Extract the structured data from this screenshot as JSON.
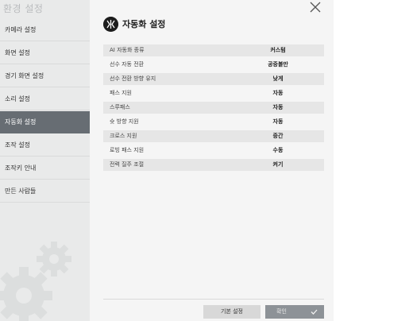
{
  "sidebar": {
    "header": "환경 설정",
    "items": [
      {
        "label": "카메라 설정"
      },
      {
        "label": "화면 설정"
      },
      {
        "label": "경기 화면 설정"
      },
      {
        "label": "소리 설정"
      },
      {
        "label": "자동화 설정"
      },
      {
        "label": "조작 설정"
      },
      {
        "label": "조작키 안내"
      },
      {
        "label": "만든 사람들"
      }
    ],
    "active_index": 4
  },
  "main": {
    "title": "자동화 설정",
    "settings": [
      {
        "label": "AI 자동화 종류",
        "value": "커스텀"
      },
      {
        "label": "선수 자동 전환",
        "value": "공중볼만"
      },
      {
        "label": "선수 전환 방향 유지",
        "value": "낮게"
      },
      {
        "label": "패스 지원",
        "value": "자동"
      },
      {
        "label": "스루패스",
        "value": "자동"
      },
      {
        "label": "슛 방향 지원",
        "value": "자동"
      },
      {
        "label": "크로스 지원",
        "value": "중간"
      },
      {
        "label": "로빙 패스 지원",
        "value": "수동"
      },
      {
        "label": "전력 질주 조절",
        "value": "켜기"
      }
    ]
  },
  "footer": {
    "default_label": "기본 설정",
    "ok_label": "확인"
  },
  "colors": {
    "sidebar_bg": "#e9eaea",
    "active_item": "#676d73",
    "panel_bg": "#f5f5f5",
    "row_shade": "#e6e6e6",
    "ok_button": "#8d9297"
  },
  "icons": {
    "close": "close-icon",
    "title": "automation-icon",
    "gears": "gears-icon",
    "check": "check-icon"
  }
}
